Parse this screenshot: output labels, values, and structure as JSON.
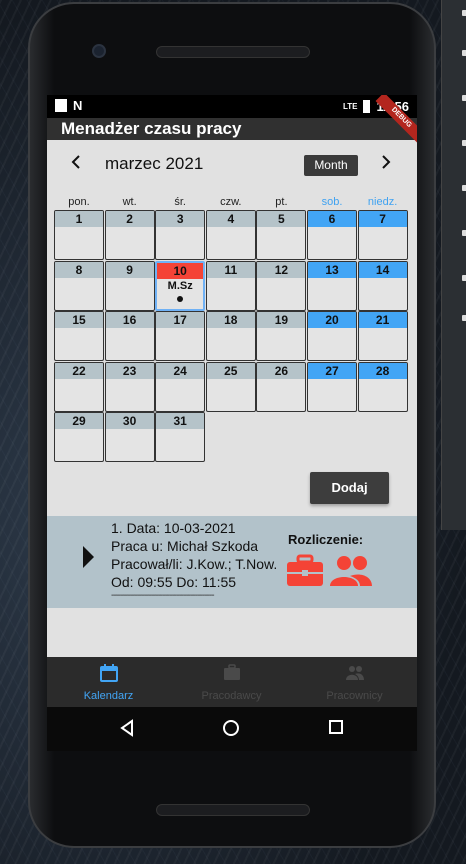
{
  "status_bar": {
    "lte": "LTE",
    "time": "11:56"
  },
  "app": {
    "title": "Menadżer czasu pracy",
    "debug": "DEBUG"
  },
  "calendar": {
    "month_label": "marzec 2021",
    "format_button": "Month",
    "weekdays": [
      "pon.",
      "wt.",
      "śr.",
      "czw.",
      "pt.",
      "sob.",
      "niedz."
    ],
    "days": [
      {
        "n": "1"
      },
      {
        "n": "2"
      },
      {
        "n": "3"
      },
      {
        "n": "4"
      },
      {
        "n": "5"
      },
      {
        "n": "6",
        "weekend": true
      },
      {
        "n": "7",
        "weekend": true
      },
      {
        "n": "8"
      },
      {
        "n": "9"
      },
      {
        "n": "10",
        "today": true,
        "event": "M.Sz"
      },
      {
        "n": "11"
      },
      {
        "n": "12"
      },
      {
        "n": "13",
        "weekend": true
      },
      {
        "n": "14",
        "weekend": true
      },
      {
        "n": "15"
      },
      {
        "n": "16"
      },
      {
        "n": "17"
      },
      {
        "n": "18"
      },
      {
        "n": "19"
      },
      {
        "n": "20",
        "weekend": true
      },
      {
        "n": "21",
        "weekend": true
      },
      {
        "n": "22"
      },
      {
        "n": "23"
      },
      {
        "n": "24"
      },
      {
        "n": "25"
      },
      {
        "n": "26"
      },
      {
        "n": "27",
        "weekend": true
      },
      {
        "n": "28",
        "weekend": true
      },
      {
        "n": "29"
      },
      {
        "n": "30"
      },
      {
        "n": "31"
      }
    ]
  },
  "add_button": "Dodaj",
  "entry": {
    "line1": "1. Data: 10-03-2021",
    "line2": "Praca u: Michał Szkoda",
    "line3": "Pracował/li: J.Kow.; T.Now.",
    "line4": "Od: 09:55 Do: 11:55",
    "separator": "--------------------------------------------",
    "settlement_label": "Rozliczenie:"
  },
  "bottom_nav": {
    "items": [
      {
        "label": "Kalendarz",
        "icon": "calendar-icon"
      },
      {
        "label": "Pracodawcy",
        "icon": "briefcase-icon"
      },
      {
        "label": "Pracownicy",
        "icon": "people-icon"
      }
    ]
  },
  "colors": {
    "accent": "#42a5f5",
    "today": "#f44336",
    "settlement_icons": "#f44336",
    "day_header": "#b5c3c9"
  }
}
